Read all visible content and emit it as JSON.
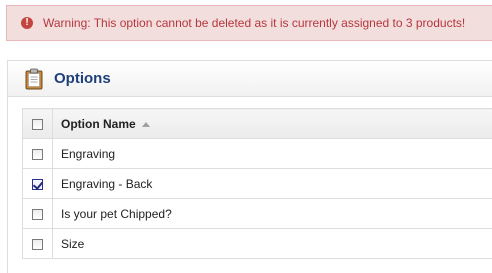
{
  "alert": {
    "message": "Warning: This option cannot be deleted as it is currently assigned to 3 products!",
    "icon": "exclamation-icon"
  },
  "panel": {
    "title": "Options",
    "icon": "clipboard-icon"
  },
  "table": {
    "header": {
      "option_name": "Option Name",
      "sort": "ascending"
    },
    "rows": [
      {
        "name": "Engraving",
        "checked": false
      },
      {
        "name": "Engraving - Back",
        "checked": true
      },
      {
        "name": "Is your pet Chipped?",
        "checked": false
      },
      {
        "name": "Size",
        "checked": false
      }
    ]
  }
}
